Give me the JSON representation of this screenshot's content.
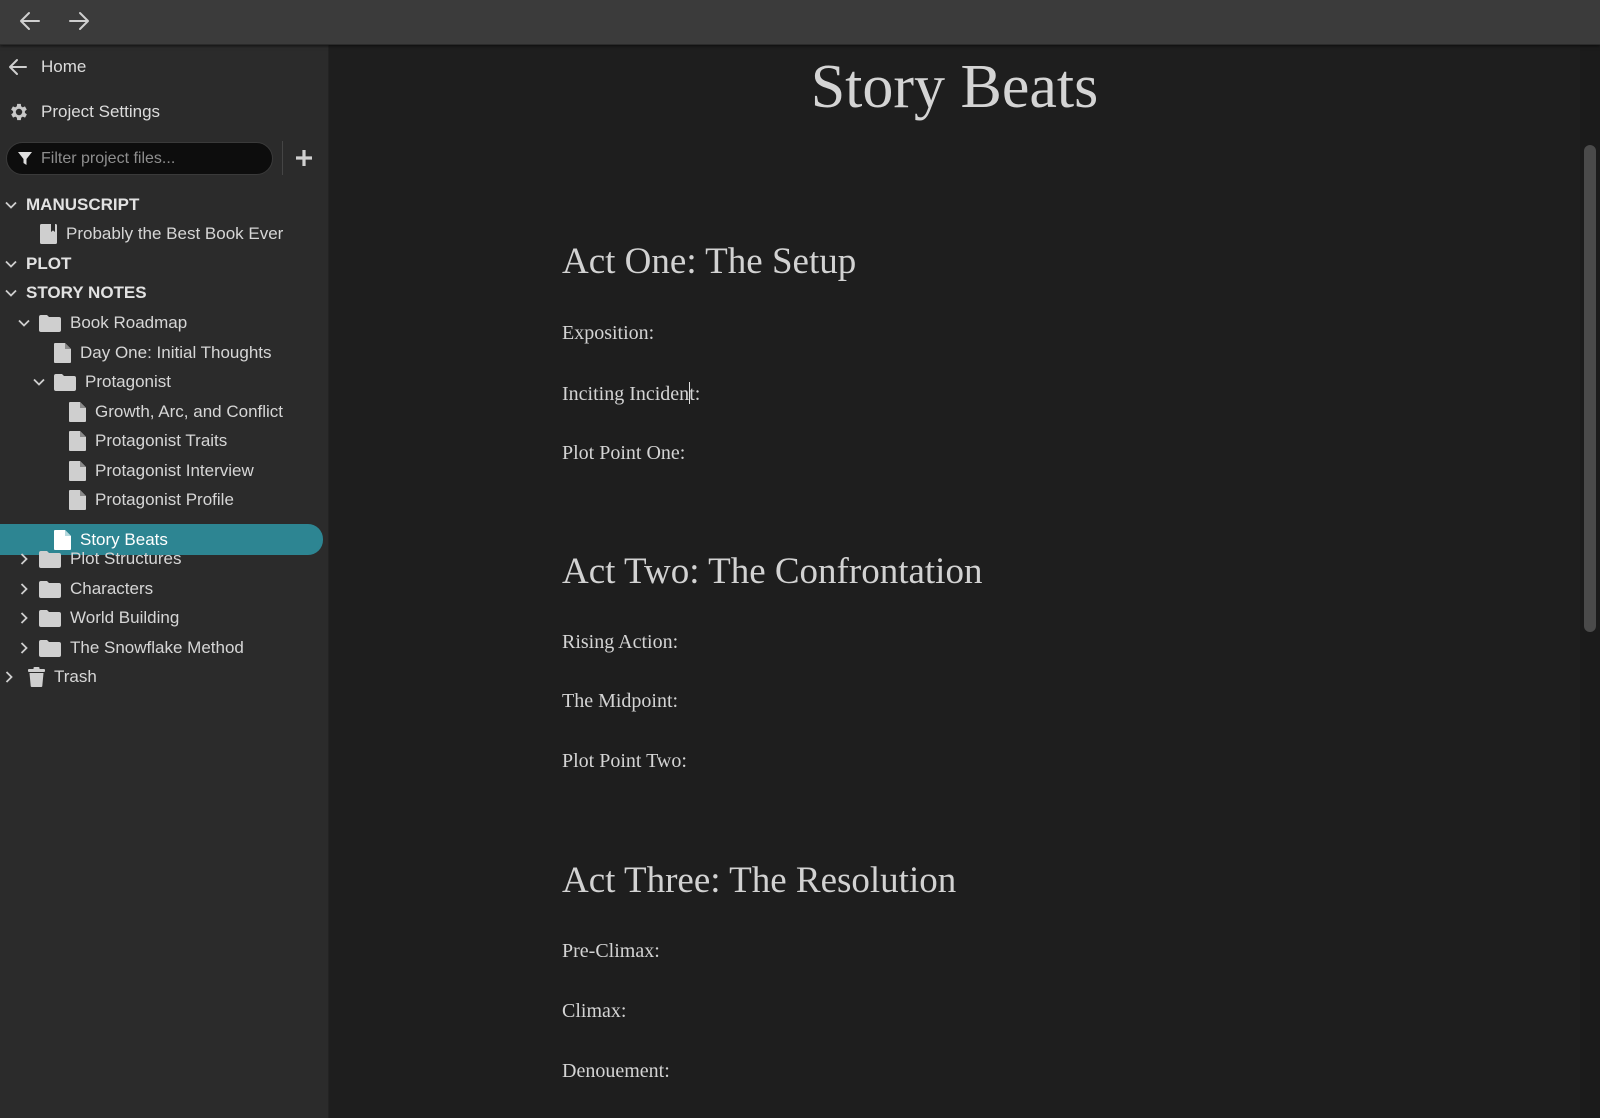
{
  "nav": {
    "back_icon": "arrow-left-icon",
    "forward_icon": "arrow-right-icon"
  },
  "sidebar": {
    "home_label": "Home",
    "settings_label": "Project Settings",
    "filter_placeholder": "Filter project files...",
    "sections": {
      "manuscript": "MANUSCRIPT",
      "plot": "PLOT",
      "story_notes": "STORY NOTES"
    },
    "manuscript_items": [
      "Probably the Best Book Ever"
    ],
    "story_notes": {
      "book_roadmap": "Book Roadmap",
      "day_one": "Day One: Initial Thoughts",
      "protagonist": "Protagonist",
      "protagonist_children": [
        "Growth, Arc, and Conflict",
        "Protagonist Traits",
        "Protagonist Interview",
        "Protagonist Profile"
      ],
      "story_beats": "Story Beats",
      "folders": [
        "Plot Structures",
        "Characters",
        "World Building",
        "The Snowflake Method"
      ]
    },
    "trash_label": "Trash",
    "accent_color": "#2d8592"
  },
  "document": {
    "title": "Story Beats",
    "acts": [
      {
        "heading": "Act One: The Setup",
        "beats": [
          "Exposition:",
          "Inciting Incident:",
          "Plot Point One:"
        ]
      },
      {
        "heading": "Act Two: The Confrontation",
        "beats": [
          "Rising Action:",
          "The Midpoint:",
          "Plot Point Two:"
        ]
      },
      {
        "heading": "Act Three: The Resolution",
        "beats": [
          "Pre-Climax:",
          "Climax:",
          "Denouement:"
        ]
      }
    ],
    "caret": {
      "before": "Inciting Inciden",
      "after": "t:"
    }
  }
}
